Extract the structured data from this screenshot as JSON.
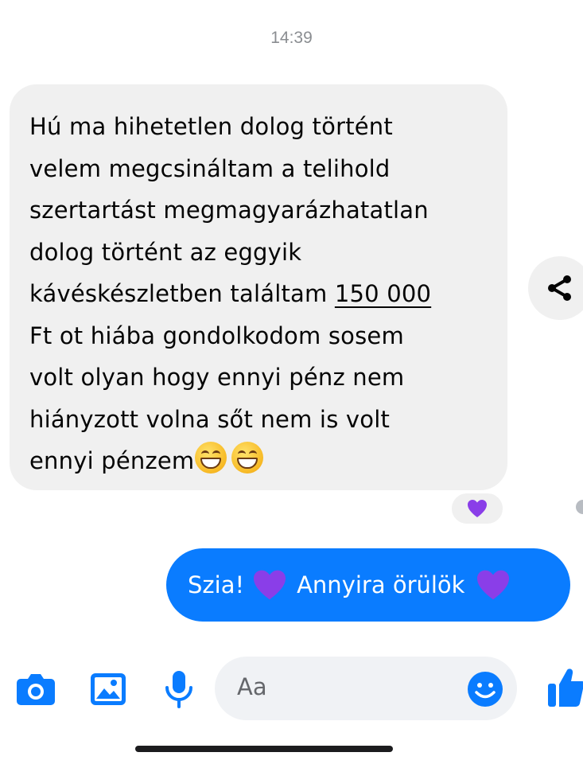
{
  "timestamp": "14:39",
  "received_message": {
    "lines": [
      "Hú ma hihetetlen dolog történt",
      "velem megcsináltam a telihold",
      "szertartást megmagyarázhatatlan",
      "dolog történt az eggyik",
      "kávéskészletben találtam ",
      "Ft ot hiába gondolkodom sosem",
      "volt olyan hogy ennyi pénz nem",
      "hiányzott volna sőt nem is volt",
      "ennyi pénzem"
    ],
    "amount": "150 000",
    "trailing_emojis": [
      "grinning-face-with-smiling-eyes",
      "grinning-face-with-smiling-eyes"
    ],
    "reaction": "purple-heart"
  },
  "sent_message": {
    "part1": "Szia!",
    "part2": "Annyira örülök",
    "emojis": [
      "purple-heart",
      "purple-heart"
    ]
  },
  "composer": {
    "placeholder": "Aa",
    "icons": [
      "camera-icon",
      "image-icon",
      "microphone-icon",
      "emoji-icon",
      "thumbs-up-icon"
    ]
  },
  "colors": {
    "accent": "#0a7cff",
    "received_bubble": "#f0f0f0",
    "heart": "#8a3ee8"
  }
}
